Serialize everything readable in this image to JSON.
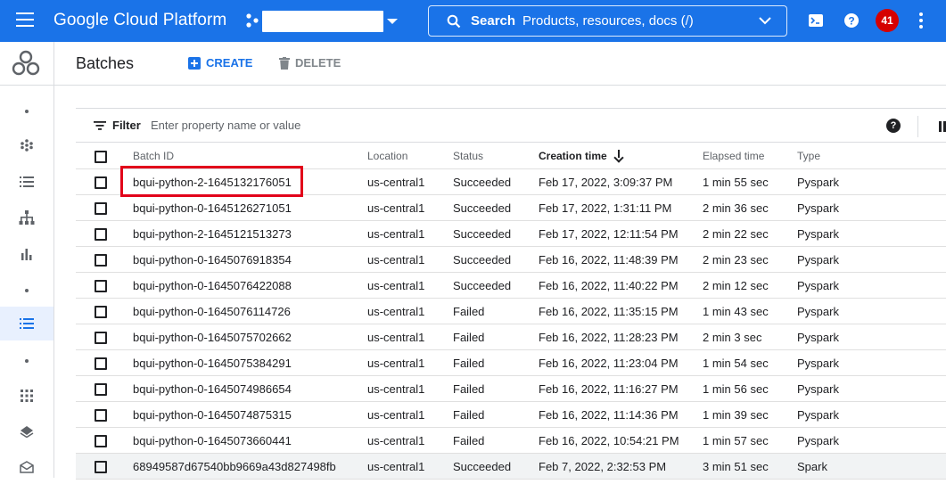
{
  "topbar": {
    "title": "Google Cloud Platform",
    "search_label": "Search",
    "search_hint": "Products, resources, docs (/)",
    "notification_count": "41",
    "brand_color": "#1a73e8",
    "badge_color": "#d50000"
  },
  "page": {
    "title": "Batches",
    "create_label": "CREATE",
    "delete_label": "DELETE"
  },
  "filter": {
    "label": "Filter",
    "placeholder": "Enter property name or value"
  },
  "table": {
    "columns": [
      "Batch ID",
      "Location",
      "Status",
      "Creation time",
      "Elapsed time",
      "Type"
    ],
    "rows": [
      {
        "id": "bqui-python-2-1645132176051",
        "location": "us-central1",
        "status": "Succeeded",
        "created": "Feb 17, 2022, 3:09:37 PM",
        "elapsed": "1 min 55 sec",
        "type": "Pyspark"
      },
      {
        "id": "bqui-python-0-1645126271051",
        "location": "us-central1",
        "status": "Succeeded",
        "created": "Feb 17, 2022, 1:31:11 PM",
        "elapsed": "2 min 36 sec",
        "type": "Pyspark"
      },
      {
        "id": "bqui-python-2-1645121513273",
        "location": "us-central1",
        "status": "Succeeded",
        "created": "Feb 17, 2022, 12:11:54 PM",
        "elapsed": "2 min 22 sec",
        "type": "Pyspark"
      },
      {
        "id": "bqui-python-0-1645076918354",
        "location": "us-central1",
        "status": "Succeeded",
        "created": "Feb 16, 2022, 11:48:39 PM",
        "elapsed": "2 min 23 sec",
        "type": "Pyspark"
      },
      {
        "id": "bqui-python-0-1645076422088",
        "location": "us-central1",
        "status": "Succeeded",
        "created": "Feb 16, 2022, 11:40:22 PM",
        "elapsed": "2 min 12 sec",
        "type": "Pyspark"
      },
      {
        "id": "bqui-python-0-1645076114726",
        "location": "us-central1",
        "status": "Failed",
        "created": "Feb 16, 2022, 11:35:15 PM",
        "elapsed": "1 min 43 sec",
        "type": "Pyspark"
      },
      {
        "id": "bqui-python-0-1645075702662",
        "location": "us-central1",
        "status": "Failed",
        "created": "Feb 16, 2022, 11:28:23 PM",
        "elapsed": "2 min 3 sec",
        "type": "Pyspark"
      },
      {
        "id": "bqui-python-0-1645075384291",
        "location": "us-central1",
        "status": "Failed",
        "created": "Feb 16, 2022, 11:23:04 PM",
        "elapsed": "1 min 54 sec",
        "type": "Pyspark"
      },
      {
        "id": "bqui-python-0-1645074986654",
        "location": "us-central1",
        "status": "Failed",
        "created": "Feb 16, 2022, 11:16:27 PM",
        "elapsed": "1 min 56 sec",
        "type": "Pyspark"
      },
      {
        "id": "bqui-python-0-1645074875315",
        "location": "us-central1",
        "status": "Failed",
        "created": "Feb 16, 2022, 11:14:36 PM",
        "elapsed": "1 min 39 sec",
        "type": "Pyspark"
      },
      {
        "id": "bqui-python-0-1645073660441",
        "location": "us-central1",
        "status": "Failed",
        "created": "Feb 16, 2022, 10:54:21 PM",
        "elapsed": "1 min 57 sec",
        "type": "Pyspark"
      },
      {
        "id": "68949587d67540bb9669a43d827498fb",
        "location": "us-central1",
        "status": "Succeeded",
        "created": "Feb 7, 2022, 2:32:53 PM",
        "elapsed": "3 min 51 sec",
        "type": "Spark"
      }
    ]
  },
  "icons": {
    "menu": "menu-icon",
    "search": "search-icon",
    "terminal": "cloud-shell-icon",
    "help": "help-icon",
    "filter": "filter-icon",
    "columns": "column-display-icon"
  }
}
